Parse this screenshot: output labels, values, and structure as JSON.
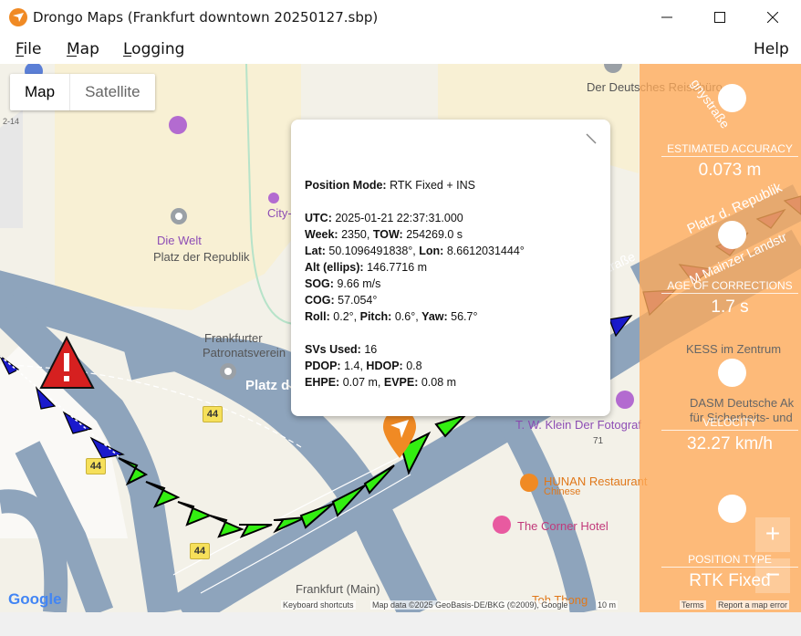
{
  "window": {
    "title": "Drongo Maps (Frankfurt downtown 20250127.sbp)",
    "minimize_icon": "minimize-icon",
    "maximize_icon": "maximize-icon",
    "close_icon": "close-icon"
  },
  "menu": {
    "file": "File",
    "map": "Map",
    "logging": "Logging",
    "help": "Help"
  },
  "map_type": {
    "map": "Map",
    "satellite": "Satellite"
  },
  "places": {
    "reisebuero": "Der Deutsches Reisebüro",
    "city": "City-",
    "diewelt": "Die Welt",
    "platz_der_republik": "Platz der Republik",
    "patronat1": "Frankfurter",
    "patronat2": "Patronatsverein",
    "platz": "Platz d",
    "kess": "KESS im Zentrum",
    "dasm1": "DASM Deutsche Ak",
    "dasm2": "für Sicherheits- und",
    "tw_klein": "T. W. Klein Der Fotograf",
    "hunan": "HUNAN Restaurant",
    "hunan_sub": "Chinese",
    "corner_hotel": "The Corner Hotel",
    "frankfurt_main": "Frankfurt (Main)",
    "toh_thong": "Toh Thong",
    "road_platz_republik": "Platz d. Republik",
    "road_strasse": "dstraße",
    "road_gnystrasse": "gnystraße",
    "road_mainzer": "M Mainzer Landstr",
    "house_71": "71",
    "route_44": "44",
    "edge_label": "2-14"
  },
  "popup": {
    "position_mode_label": "Position Mode:",
    "position_mode_value": "RTK Fixed + INS",
    "utc_label": "UTC:",
    "utc_value": "2025-01-21 22:37:31.000",
    "week_label": "Week:",
    "week_value": "2350,",
    "tow_label": "TOW:",
    "tow_value": "254269.0 s",
    "lat_label": "Lat:",
    "lat_value": "50.1096491838°,",
    "lon_label": "Lon:",
    "lon_value": "8.6612031444°",
    "alt_label": "Alt (ellips):",
    "alt_value": "146.7716 m",
    "sog_label": "SOG:",
    "sog_value": "9.66 m/s",
    "cog_label": "COG:",
    "cog_value": "57.054°",
    "roll_label": "Roll:",
    "roll_value": "0.2°,",
    "pitch_label": "Pitch:",
    "pitch_value": "0.6°,",
    "yaw_label": "Yaw:",
    "yaw_value": "56.7°",
    "svs_label": "SVs Used:",
    "svs_value": "16",
    "pdop_label": "PDOP:",
    "pdop_value": "1.4,",
    "hdop_label": "HDOP:",
    "hdop_value": "0.8",
    "ehpe_label": "EHPE:",
    "ehpe_value": "0.07 m,",
    "evpe_label": "EVPE:",
    "evpe_value": "0.08 m"
  },
  "panel": {
    "accuracy_label": "ESTIMATED ACCURACY",
    "accuracy_value": "0.073 m",
    "corrections_label": "AGE OF CORRECTIONS",
    "corrections_value": "1.7 s",
    "velocity_label": "VELOCITY",
    "velocity_value": "32.27 km/h",
    "position_type_label": "POSITION TYPE",
    "position_type_value": "RTK Fixed"
  },
  "zoom": {
    "in": "+",
    "out": "−"
  },
  "attribution": {
    "google": "Google",
    "shortcuts": "Keyboard shortcuts",
    "map_data": "Map data ©2025 GeoBasis-DE/BKG (©2009), Google",
    "scale": "10 m",
    "terms": "Terms",
    "report": "Report a map error"
  },
  "colors": {
    "panel_orange": "#ffaa5a",
    "road_blue": "#8ea4bc",
    "arrow_green": "#33ee11",
    "arrow_blue": "#1a1acc",
    "arrow_purple": "#7a3d8c",
    "warning_red": "#d62020",
    "marker_orange": "#f08a24"
  }
}
